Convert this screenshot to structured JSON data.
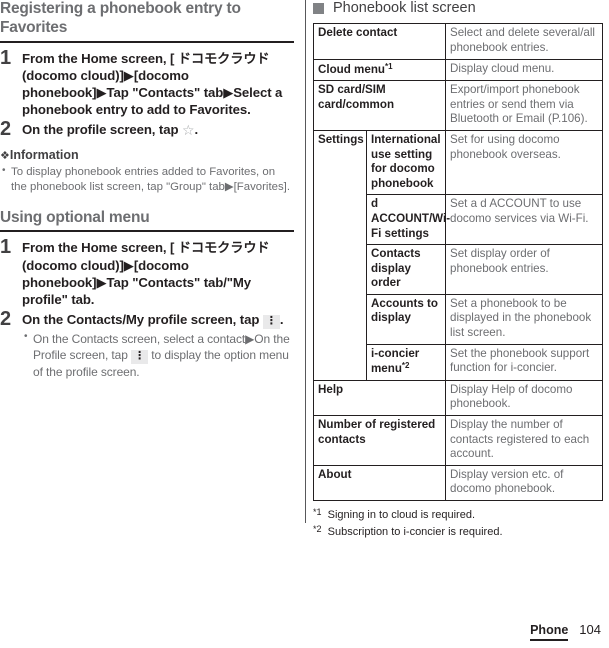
{
  "left": {
    "section1": {
      "heading": "Registering a phonebook entry to Favorites",
      "steps": [
        {
          "num": "1",
          "text": "From the Home screen, [ ドコモクラウド (docomo cloud)]▶[docomo phonebook]▶Tap \"Contacts\" tab▶Select a phonebook entry to add to Favorites."
        },
        {
          "num": "2",
          "text_before": "On the profile screen, tap",
          "icon": "star-outline-icon",
          "icon_glyph": "☆",
          "text_after": "."
        }
      ],
      "info_heading": "Information",
      "info_bullet": "❖",
      "info_items": [
        "To display phonebook entries added to Favorites, on the phonebook list screen, tap \"Group\" tab▶[Favorites]."
      ]
    },
    "section2": {
      "heading": "Using optional menu",
      "steps": [
        {
          "num": "1",
          "text": "From the Home screen, [ ドコモクラウド (docomo cloud)]▶[docomo phonebook]▶Tap \"Contacts\" tab/\"My profile\" tab."
        },
        {
          "num": "2",
          "text_before": "On the Contacts/My profile screen, tap",
          "icon": "kebab-menu-icon",
          "icon_glyph": "⋮",
          "text_after": "."
        }
      ],
      "substeps": [
        {
          "part1": "On the Contacts screen, select a contact▶On the Profile screen, tap",
          "icon": "kebab-menu-icon",
          "icon_glyph": "⋮",
          "part2": "to display the option menu of the profile screen."
        }
      ]
    }
  },
  "right": {
    "heading": "Phonebook list screen",
    "heading_icon": "filled-square-icon",
    "rows": [
      {
        "key": "Delete contact",
        "sup": "",
        "sub": "",
        "sub_sup": "",
        "value": "Select and delete several/all phonebook entries."
      },
      {
        "key": "Cloud menu",
        "sup": "*1",
        "sub": "",
        "sub_sup": "",
        "value": "Display cloud menu."
      },
      {
        "key": "SD card/SIM card/common",
        "sup": "",
        "sub": "",
        "sub_sup": "",
        "value": "Export/import phonebook entries or send them via Bluetooth or Email (P.106)."
      },
      {
        "key": "Settings",
        "sup": "",
        "sub": "International use setting for docomo phonebook",
        "sub_sup": "",
        "value": "Set for using docomo phonebook overseas.",
        "rowspan": 5
      },
      {
        "key": "",
        "sup": "",
        "sub": "d ACCOUNT/Wi-Fi settings",
        "sub_sup": "",
        "value": "Set a d ACCOUNT to use docomo services via Wi-Fi."
      },
      {
        "key": "",
        "sup": "",
        "sub": "Contacts display order",
        "sub_sup": "",
        "value": "Set display order of phonebook entries."
      },
      {
        "key": "",
        "sup": "",
        "sub": "Accounts to display",
        "sub_sup": "",
        "value": "Set a phonebook to be displayed in the phonebook list screen."
      },
      {
        "key": "",
        "sup": "",
        "sub": "i-concier menu",
        "sub_sup": "*2",
        "value": "Set the phonebook support function for i-concier."
      },
      {
        "key": "Help",
        "sup": "",
        "sub": "",
        "sub_sup": "",
        "value": "Display Help of docomo phonebook."
      },
      {
        "key": "Number of registered contacts",
        "sup": "",
        "sub": "",
        "sub_sup": "",
        "value": "Display the number of contacts registered to each account."
      },
      {
        "key": "About",
        "sup": "",
        "sub": "",
        "sub_sup": "",
        "value": "Display version etc. of docomo phonebook."
      }
    ],
    "footnotes": [
      {
        "mark": "*1",
        "text": "Signing in to cloud is required."
      },
      {
        "mark": "*2",
        "text": "Subscription to i-concier is required."
      }
    ]
  },
  "footer": {
    "chapter": "Phone",
    "page": "104"
  }
}
